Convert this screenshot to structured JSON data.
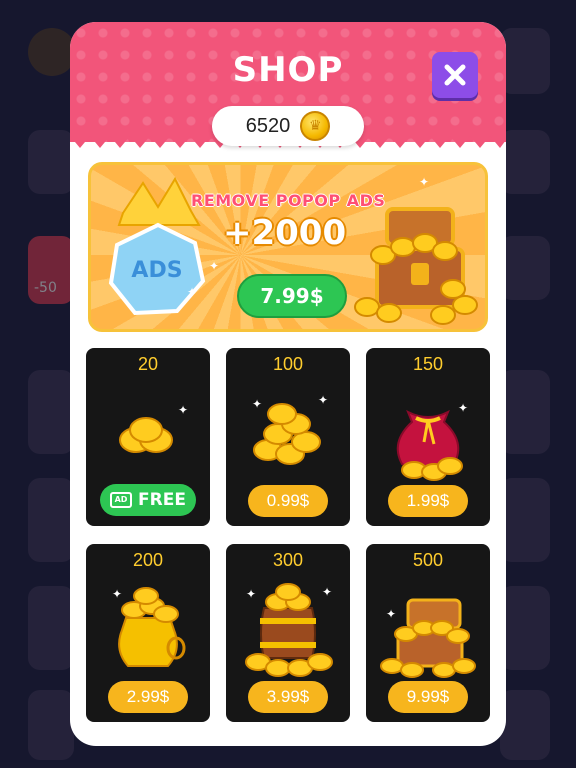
{
  "shop": {
    "title": "SHOP",
    "balance": "6520",
    "close_icon": "close-icon",
    "accent_color": "#f2557a",
    "close_button_color": "#8d4de8"
  },
  "banner": {
    "badge_text": "ADS",
    "title": "REMOVE POPOP ADS",
    "amount": "+2000",
    "price": "7.99$"
  },
  "packs": [
    {
      "amount": "20",
      "price": "FREE",
      "type": "ad",
      "art": "coin-stack-small-icon"
    },
    {
      "amount": "100",
      "price": "0.99$",
      "type": "paid",
      "art": "coin-pile-icon"
    },
    {
      "amount": "150",
      "price": "1.99$",
      "type": "paid",
      "art": "coin-sack-icon"
    },
    {
      "amount": "200",
      "price": "2.99$",
      "type": "paid",
      "art": "coin-pot-icon"
    },
    {
      "amount": "300",
      "price": "3.99$",
      "type": "paid",
      "art": "coin-barrel-icon"
    },
    {
      "amount": "500",
      "price": "9.99$",
      "type": "paid",
      "art": "treasure-chest-icon"
    }
  ],
  "background": {
    "left_label": "-50"
  }
}
